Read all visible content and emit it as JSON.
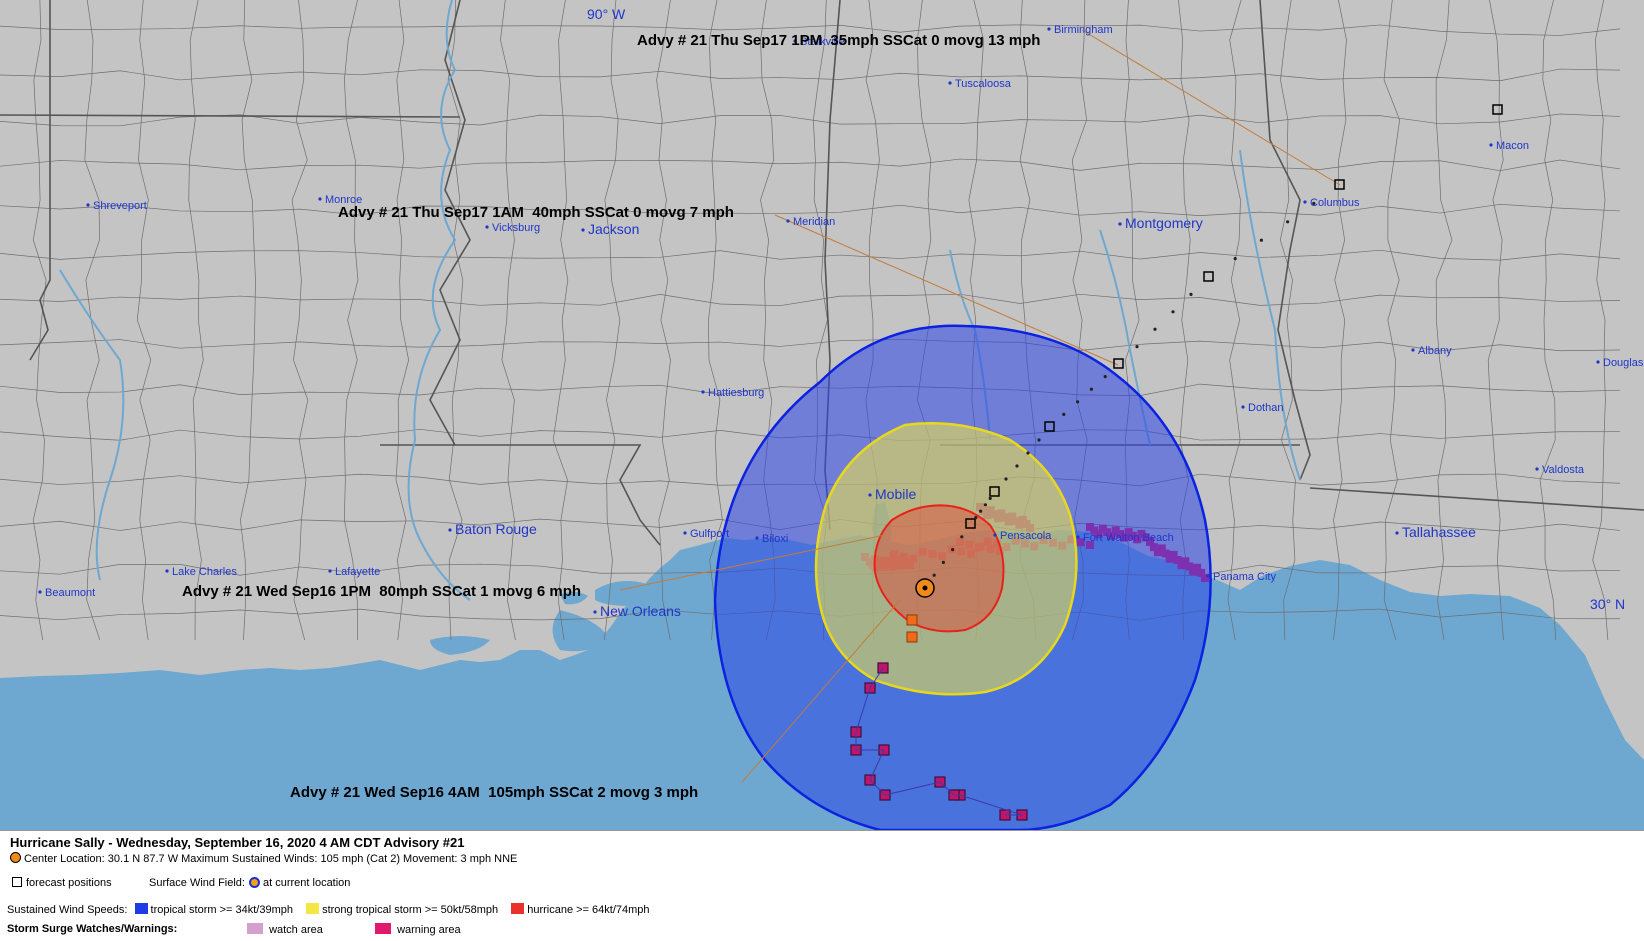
{
  "map": {
    "longitude_label": "90° W",
    "latitude_label": "30° N",
    "cities": [
      {
        "id": "birmingham",
        "name": "Birmingham"
      },
      {
        "id": "starkville",
        "name": "Starkville"
      },
      {
        "id": "tuscaloosa",
        "name": "Tuscaloosa"
      },
      {
        "id": "macon",
        "name": "Macon"
      },
      {
        "id": "columbus",
        "name": "Columbus"
      },
      {
        "id": "shreveport",
        "name": "Shreveport"
      },
      {
        "id": "monroe",
        "name": "Monroe"
      },
      {
        "id": "vicksburg",
        "name": "Vicksburg"
      },
      {
        "id": "jackson",
        "name": "Jackson"
      },
      {
        "id": "meridian",
        "name": "Meridian"
      },
      {
        "id": "montgomery",
        "name": "Montgomery"
      },
      {
        "id": "albany",
        "name": "Albany"
      },
      {
        "id": "douglas",
        "name": "Douglas"
      },
      {
        "id": "hattiesburg",
        "name": "Hattiesburg"
      },
      {
        "id": "dothan",
        "name": "Dothan"
      },
      {
        "id": "valdosta",
        "name": "Valdosta"
      },
      {
        "id": "mobile",
        "name": "Mobile"
      },
      {
        "id": "baton_rouge",
        "name": "Baton Rouge"
      },
      {
        "id": "gulfport",
        "name": "Gulfport"
      },
      {
        "id": "biloxi",
        "name": "Biloxi"
      },
      {
        "id": "pensacola",
        "name": "Pensacola"
      },
      {
        "id": "fort_walton_beach",
        "name": "Fort Walton Beach"
      },
      {
        "id": "tallahassee",
        "name": "Tallahassee"
      },
      {
        "id": "lake_charles",
        "name": "Lake Charles"
      },
      {
        "id": "lafayette",
        "name": "Lafayette"
      },
      {
        "id": "panama_city",
        "name": "Panama City"
      },
      {
        "id": "beaumont",
        "name": "Beaumont"
      },
      {
        "id": "new_orleans",
        "name": "New Orleans"
      }
    ],
    "advisories": [
      {
        "id": "thu1pm",
        "text": "Advy # 21 Thu Sep17 1PM  35mph SSCat 0 movg 13 mph"
      },
      {
        "id": "thu1am",
        "text": "Advy # 21 Thu Sep17 1AM  40mph SSCat 0 movg 7 mph"
      },
      {
        "id": "wed1pm",
        "text": "Advy # 21 Wed Sep16 1PM  80mph SSCat 1 movg 6 mph"
      },
      {
        "id": "wed4am",
        "text": "Advy # 21 Wed Sep16 4AM  105mph SSCat 2 movg 3 mph"
      }
    ],
    "colors": {
      "land": "#c4c4c4",
      "water": "#6ea8d0",
      "tropical_storm": "#1f3be6",
      "strong_tropical_storm": "#f2e744",
      "hurricane": "#e8322a",
      "surge_watch": "#d6a0cc",
      "surge_warning": "#e0196e",
      "track_line": "#c47b3a"
    }
  },
  "legend": {
    "title": "Hurricane Sally  -  Wednesday, September 16, 2020  4 AM CDT   Advisory #21",
    "center_location": "Center Location: 30.1 N  87.7 W   Maximum Sustained Winds: 105 mph (Cat 2)  Movement: 3 mph NNE",
    "forecast_positions": "forecast positions",
    "surface_wind_field": "Surface Wind Field:",
    "at_current_location": "at current location",
    "sustained_wind_speeds": "Sustained Wind Speeds:",
    "tropical_storm": "tropical storm >= 34kt/39mph",
    "strong_tropical_storm": "strong tropical storm >= 50kt/58mph",
    "hurricane": "hurricane >= 64kt/74mph",
    "storm_surge": "Storm Surge Watches/Warnings:",
    "watch_area": "watch area",
    "warning_area": "warning area"
  }
}
